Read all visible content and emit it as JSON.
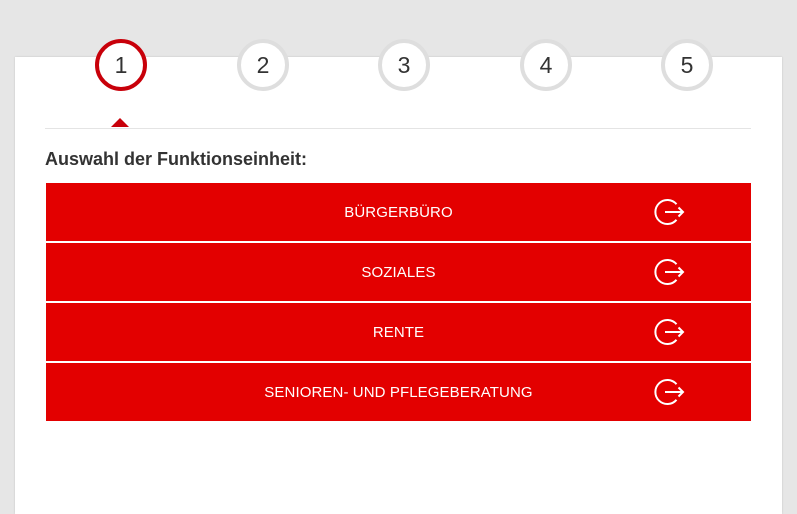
{
  "stepper": {
    "steps": [
      {
        "label": "1",
        "active": true
      },
      {
        "label": "2",
        "active": false
      },
      {
        "label": "3",
        "active": false
      },
      {
        "label": "4",
        "active": false
      },
      {
        "label": "5",
        "active": false
      }
    ]
  },
  "section": {
    "heading": "Auswahl der Funktionseinheit:"
  },
  "options": [
    {
      "label": "BÜRGERBÜRO",
      "icon": "exit-arrow-icon"
    },
    {
      "label": "SOZIALES",
      "icon": "exit-arrow-icon"
    },
    {
      "label": "RENTE",
      "icon": "exit-arrow-icon"
    },
    {
      "label": "SENIOREN- UND PFLEGEBERATUNG",
      "icon": "exit-arrow-icon"
    }
  ],
  "colors": {
    "accent": "#e30000",
    "active_step_ring": "#c8000a",
    "inactive_step_ring": "#dedede",
    "background": "#e6e6e6"
  }
}
